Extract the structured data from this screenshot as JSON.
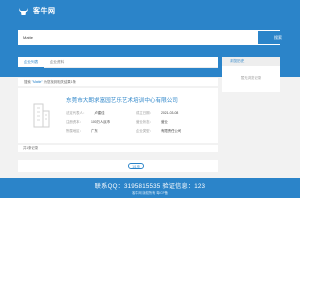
{
  "header": {
    "logo_text": "客牛网",
    "search_value": "Matte",
    "search_button": "搜索"
  },
  "tabs": [
    {
      "label": "企业列表",
      "active": true
    },
    {
      "label": "企业资料",
      "active": false
    },
    {
      "label": "",
      "active": false
    },
    {
      "label": "",
      "active": false
    },
    {
      "label": "",
      "active": false
    }
  ],
  "notice": {
    "prefix": "搜索 ",
    "keyword": "\"Matte\"",
    "suffix": " 为您找到相关结果1条"
  },
  "result": {
    "company_name": "东莞市大朗求富园艺乐艺术培训中心有限公司",
    "legal_label": "法定代表人：",
    "legal_value": "卢建佳",
    "date_label": "成立日期：",
    "date_value": "2021-03-08",
    "capital_label": "注册资本：",
    "capital_value": "100万人民币",
    "status_label": "营业状态：",
    "status_value": "营业",
    "region_label": "所属地区：",
    "region_value": "广东",
    "type_label": "企业类型：",
    "type_value": "有限责任公司"
  },
  "result_footer": "共1条记录",
  "pager": {
    "button_label": "1/1页"
  },
  "side": {
    "title": "浏览历史",
    "empty_text": "暂无浏览记录"
  },
  "footer": {
    "contact": "联系QQ：3195815535  验证信息：123",
    "sub": "客牛网 版权所有 粤ICP备"
  },
  "colors": {
    "brand": "#2b84c9",
    "background": "#f2f2f2"
  }
}
